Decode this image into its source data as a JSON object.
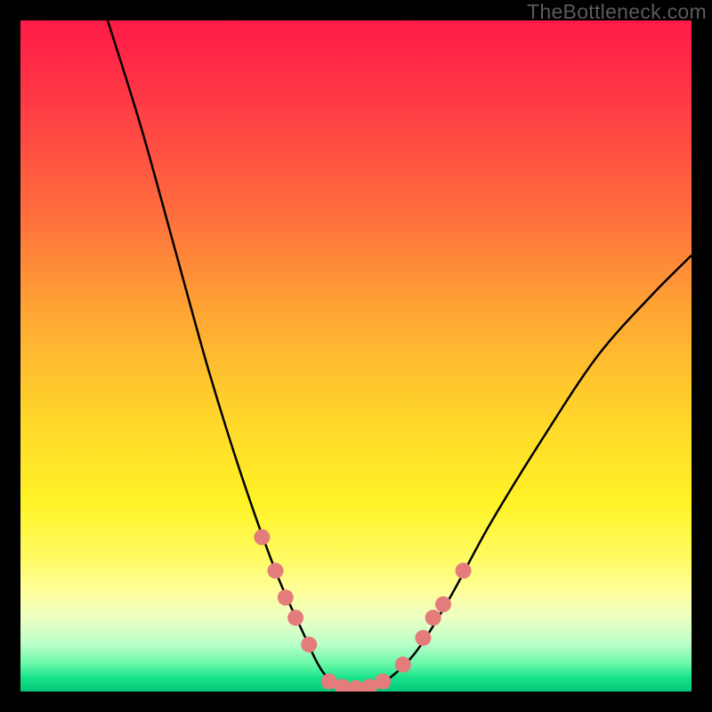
{
  "watermark": "TheBottleneck.com",
  "colors": {
    "curve_stroke": "#000000",
    "marker_fill": "#e47c7c",
    "marker_stroke": "#c15d5d"
  },
  "chart_data": {
    "type": "line",
    "title": "",
    "xlabel": "",
    "ylabel": "",
    "xlim": [
      0,
      100
    ],
    "ylim": [
      0,
      100
    ],
    "curve": [
      {
        "x": 13,
        "y": 100
      },
      {
        "x": 18,
        "y": 84
      },
      {
        "x": 23,
        "y": 66
      },
      {
        "x": 28,
        "y": 48
      },
      {
        "x": 33,
        "y": 32
      },
      {
        "x": 38,
        "y": 18
      },
      {
        "x": 42,
        "y": 9
      },
      {
        "x": 45,
        "y": 3
      },
      {
        "x": 48,
        "y": 0.5
      },
      {
        "x": 52,
        "y": 0.5
      },
      {
        "x": 55,
        "y": 2
      },
      {
        "x": 59,
        "y": 6
      },
      {
        "x": 64,
        "y": 14
      },
      {
        "x": 70,
        "y": 25
      },
      {
        "x": 78,
        "y": 38
      },
      {
        "x": 86,
        "y": 50
      },
      {
        "x": 94,
        "y": 59
      },
      {
        "x": 100,
        "y": 65
      }
    ],
    "markers": [
      {
        "x": 36,
        "y": 23
      },
      {
        "x": 38,
        "y": 18
      },
      {
        "x": 39.5,
        "y": 14
      },
      {
        "x": 41,
        "y": 11
      },
      {
        "x": 43,
        "y": 7
      },
      {
        "x": 46,
        "y": 1.5
      },
      {
        "x": 48,
        "y": 0.7
      },
      {
        "x": 50,
        "y": 0.5
      },
      {
        "x": 52,
        "y": 0.7
      },
      {
        "x": 54,
        "y": 1.5
      },
      {
        "x": 57,
        "y": 4
      },
      {
        "x": 60,
        "y": 8
      },
      {
        "x": 61.5,
        "y": 11
      },
      {
        "x": 63,
        "y": 13
      },
      {
        "x": 66,
        "y": 18
      }
    ]
  }
}
